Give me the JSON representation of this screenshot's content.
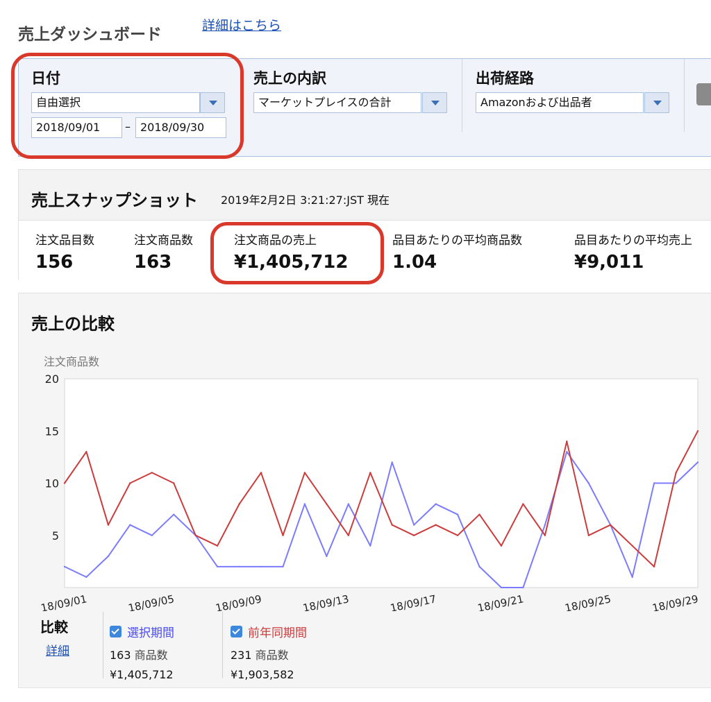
{
  "header": {
    "title": "売上ダッシュボード",
    "details_link": "詳細はこちら"
  },
  "filters": {
    "date": {
      "label": "日付",
      "select_value": "自由選択",
      "start_date": "2018/09/01",
      "separator": "–",
      "end_date": "2018/09/30"
    },
    "breakdown": {
      "label": "売上の内訳",
      "select_value": "マーケットプレイスの合計"
    },
    "fulfillment": {
      "label": "出荷経路",
      "select_value": "Amazonおよび出品者"
    }
  },
  "snapshot": {
    "title": "売上スナップショット",
    "timestamp": "2019年2月2日 3:21:27:JST 現在",
    "metrics": [
      {
        "label": "注文品目数",
        "value": "156"
      },
      {
        "label": "注文商品数",
        "value": "163"
      },
      {
        "label": "注文商品の売上",
        "value": "¥1,405,712"
      },
      {
        "label": "品目あたりの平均商品数",
        "value": "1.04"
      },
      {
        "label": "品目あたりの平均売上",
        "value": "¥9,011"
      }
    ]
  },
  "comparison": {
    "title": "売上の比較",
    "legend_title": "比較",
    "legend_detail_link": "詳細",
    "series_items": [
      {
        "name": "選択期間",
        "color": "#7b7bff",
        "units": "163",
        "unit_label": "商品数",
        "sales": "¥1,405,712"
      },
      {
        "name": "前年同期間",
        "color": "#cc3b3b",
        "units": "231",
        "unit_label": "商品数",
        "sales": "¥1,903,582"
      }
    ]
  },
  "chart_data": {
    "type": "line",
    "ylabel": "注文商品数",
    "ylim": [
      0,
      20
    ],
    "yticks": [
      5,
      10,
      15,
      20
    ],
    "x": [
      "18/09/01",
      "18/09/02",
      "18/09/03",
      "18/09/04",
      "18/09/05",
      "18/09/06",
      "18/09/07",
      "18/09/08",
      "18/09/09",
      "18/09/10",
      "18/09/11",
      "18/09/12",
      "18/09/13",
      "18/09/14",
      "18/09/15",
      "18/09/16",
      "18/09/17",
      "18/09/18",
      "18/09/19",
      "18/09/20",
      "18/09/21",
      "18/09/22",
      "18/09/23",
      "18/09/24",
      "18/09/25",
      "18/09/26",
      "18/09/27",
      "18/09/28",
      "18/09/29",
      "18/09/30"
    ],
    "xtick_labels": [
      "18/09/01",
      "18/09/05",
      "18/09/09",
      "18/09/13",
      "18/09/17",
      "18/09/21",
      "18/09/25",
      "18/09/29"
    ],
    "grid": false,
    "series": [
      {
        "name": "選択期間",
        "color": "#7b7bff",
        "values": [
          2,
          1,
          3,
          6,
          5,
          7,
          5,
          2,
          2,
          2,
          2,
          8,
          3,
          8,
          4,
          12,
          6,
          8,
          7,
          2,
          0,
          0,
          6,
          13,
          10,
          6,
          1,
          10,
          10,
          12
        ]
      },
      {
        "name": "前年同期間",
        "color": "#cc3b3b",
        "values": [
          10,
          13,
          6,
          10,
          11,
          10,
          5,
          4,
          8,
          11,
          5,
          11,
          8,
          5,
          11,
          6,
          5,
          6,
          5,
          7,
          4,
          8,
          5,
          14,
          5,
          6,
          4,
          2,
          11,
          15
        ]
      }
    ]
  }
}
